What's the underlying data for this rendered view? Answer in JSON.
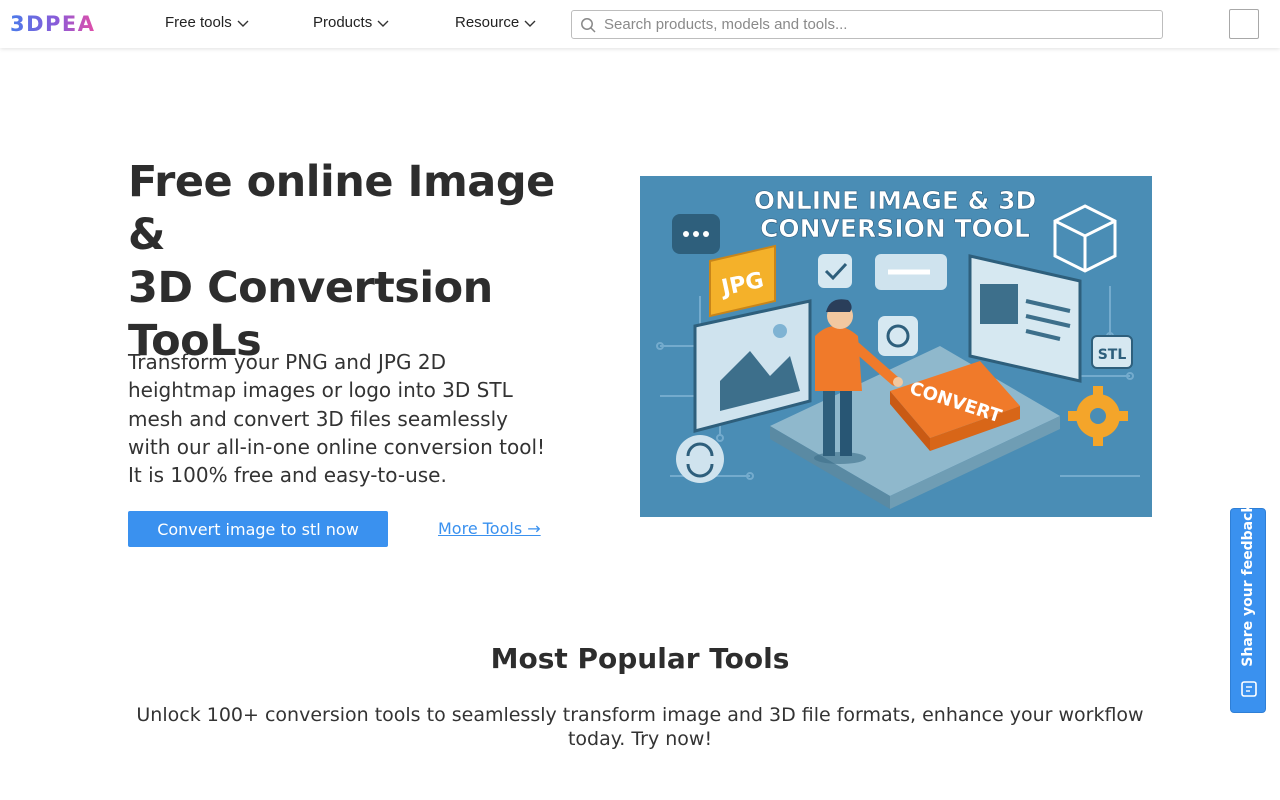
{
  "header": {
    "logo_text": "3DPEA",
    "nav": [
      {
        "label": "Free tools"
      },
      {
        "label": "Products"
      },
      {
        "label": "Resource"
      }
    ],
    "search": {
      "placeholder": "Search products, models and tools..."
    }
  },
  "hero": {
    "title_lines": [
      "Free online Image &",
      "3D Convertsion",
      "TooLs"
    ],
    "description": "Transform your PNG and JPG 2D heightmap images or logo into 3D STL mesh and convert 3D files seamlessly with our all-in-one online conversion tool! It is 100% free and easy-to-use.",
    "cta_label": "Convert image to stl now",
    "more_link": "More Tools →",
    "image": {
      "headline_lines": [
        "ONLINE IMAGE & 3D",
        "CONVERSION TOOL"
      ],
      "jpg_label": "JPG",
      "stl_label": "STL",
      "convert_label": "CONVERT"
    }
  },
  "popular": {
    "title": "Most Popular Tools",
    "description": "Unlock 100+ conversion tools to seamlessly transform image and 3D file formats, enhance your workflow today. Try now!"
  },
  "feedback": {
    "label": "Share your feedback"
  },
  "colors": {
    "accent": "#3a91ef",
    "illustration_bg": "#4a8db5",
    "convert_orange": "#f07a2a"
  }
}
